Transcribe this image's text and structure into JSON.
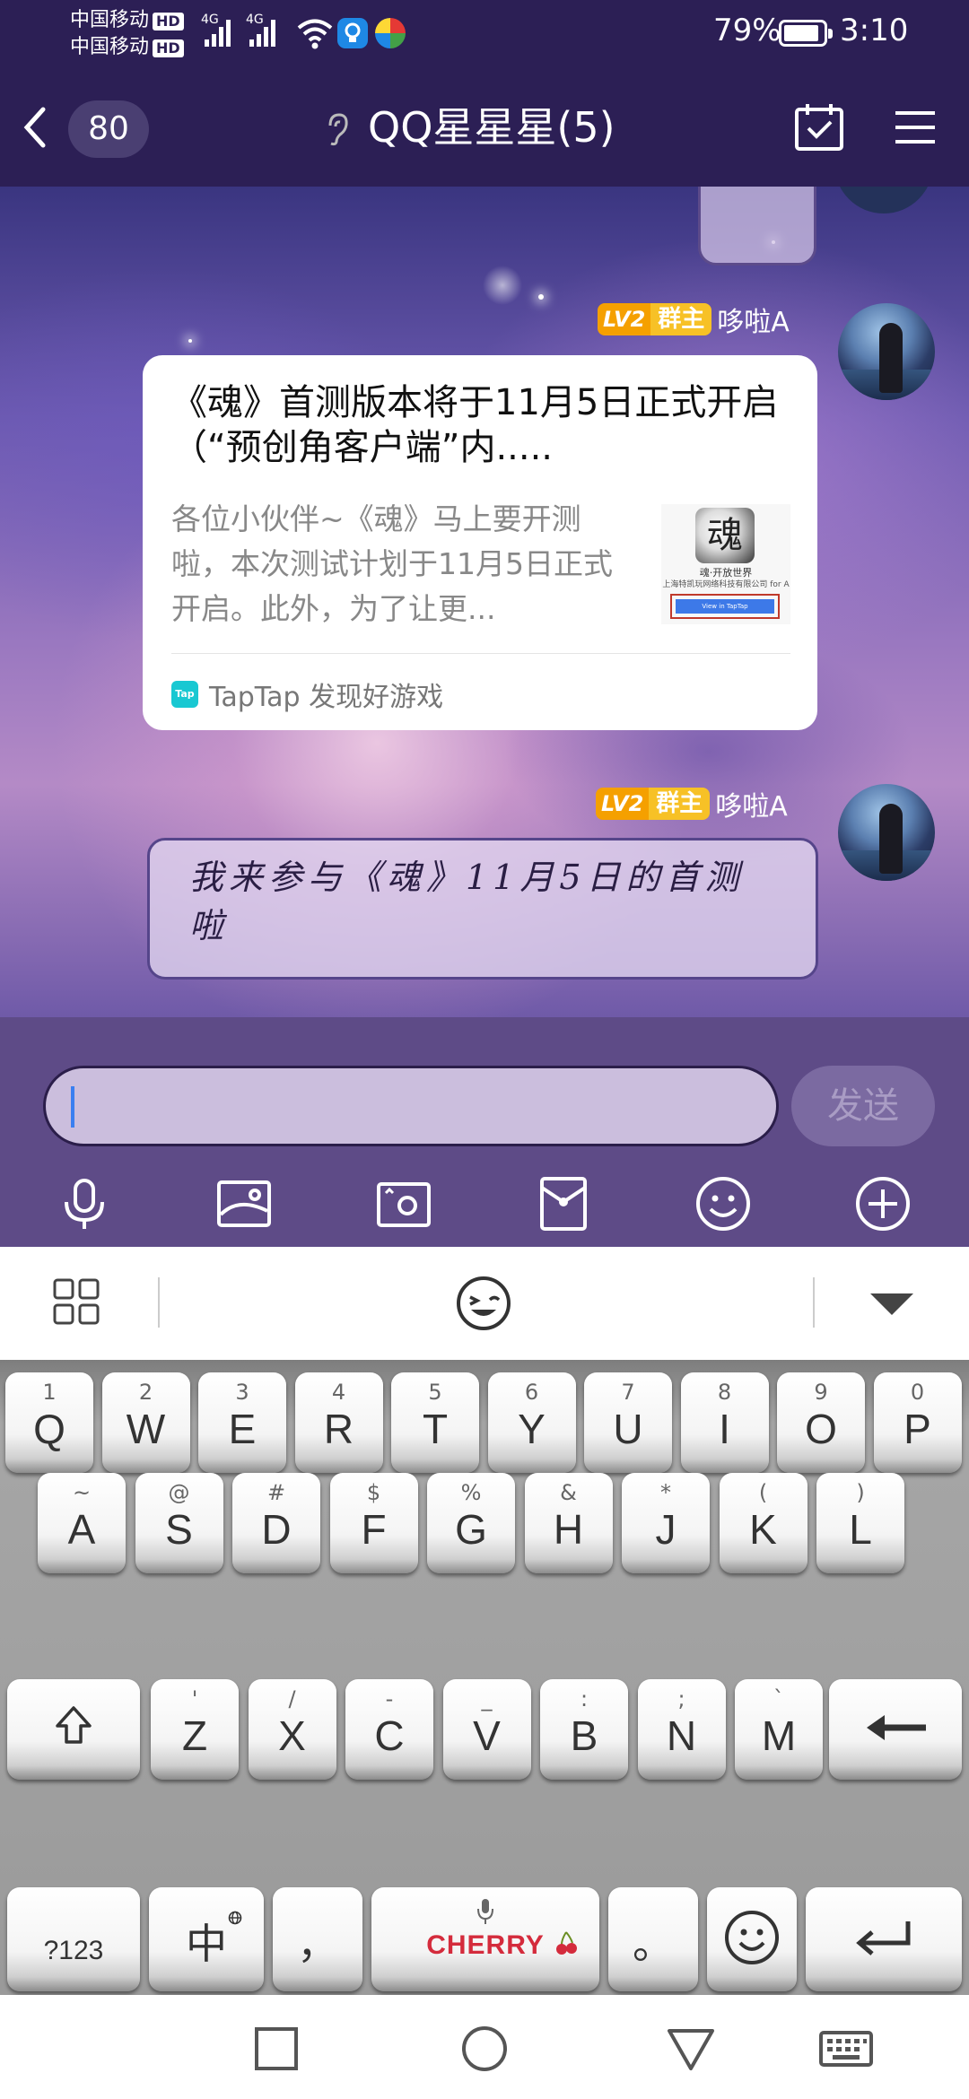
{
  "status": {
    "carrier1": "中国移动",
    "carrier2": "中国移动",
    "hd": "HD",
    "net": "4G",
    "battery_pct": "79%",
    "time": "3:10"
  },
  "header": {
    "unread": "80",
    "title": "QQ星星星(5)"
  },
  "messages": [
    {
      "level": "LV2",
      "role": "群主",
      "sender": "哆啦A",
      "type": "share-card",
      "card": {
        "title": "《魂》首测版本将于11月5日正式开启（“预创角客户端”内.....",
        "desc": "各位小伙伴~《魂》马上要开测啦，本次测试计划于11月5日正式开启。此外，为了让更...",
        "thumb_logo": "魂",
        "thumb_line1": "魂·开放世界",
        "thumb_line2": "上海特凯玩网络科技有限公司 for A",
        "thumb_button": "View in TapTap",
        "source_icon": "Tap",
        "source": "TapTap 发现好游戏"
      }
    },
    {
      "level": "LV2",
      "role": "群主",
      "sender": "哆啦A",
      "type": "handwriting",
      "text": "我来参与《魂》11月5日的首测啦"
    }
  ],
  "input": {
    "send_label": "发送"
  },
  "keyboard": {
    "row1": [
      {
        "sub": "1",
        "main": "Q"
      },
      {
        "sub": "2",
        "main": "W"
      },
      {
        "sub": "3",
        "main": "E"
      },
      {
        "sub": "4",
        "main": "R"
      },
      {
        "sub": "5",
        "main": "T"
      },
      {
        "sub": "6",
        "main": "Y"
      },
      {
        "sub": "7",
        "main": "U"
      },
      {
        "sub": "8",
        "main": "I"
      },
      {
        "sub": "9",
        "main": "O"
      },
      {
        "sub": "0",
        "main": "P"
      }
    ],
    "row2": [
      {
        "sub": "~",
        "main": "A"
      },
      {
        "sub": "@",
        "main": "S"
      },
      {
        "sub": "#",
        "main": "D"
      },
      {
        "sub": "$",
        "main": "F"
      },
      {
        "sub": "%",
        "main": "G"
      },
      {
        "sub": "&",
        "main": "H"
      },
      {
        "sub": "*",
        "main": "J"
      },
      {
        "sub": "(",
        "main": "K"
      },
      {
        "sub": ")",
        "main": "L"
      }
    ],
    "row3": [
      {
        "sub": "'",
        "main": "Z"
      },
      {
        "sub": "/",
        "main": "X"
      },
      {
        "sub": "-",
        "main": "C"
      },
      {
        "sub": "_",
        "main": "V"
      },
      {
        "sub": ":",
        "main": "B"
      },
      {
        "sub": ";",
        "main": "N"
      },
      {
        "sub": "`",
        "main": "M"
      }
    ],
    "sym_label": "?123",
    "lang_label": "中",
    "comma": "，",
    "space_brand": "CHERRY",
    "period": "。"
  },
  "icons": {
    "back": "chevron-left-icon",
    "ear": "ear-icon",
    "calendar": "calendar-check-icon",
    "menu": "hamburger-menu-icon",
    "tools": [
      "microphone-icon",
      "image-icon",
      "camera-icon",
      "red-packet-icon",
      "emoji-icon",
      "plus-icon"
    ]
  },
  "colors": {
    "header_bg": "#2c1f55",
    "input_bar_bg": "#5e4b87",
    "badge_gold": "#f7c126",
    "send_disabled": "#7b6aa1",
    "brand_red": "#d42b3c"
  }
}
